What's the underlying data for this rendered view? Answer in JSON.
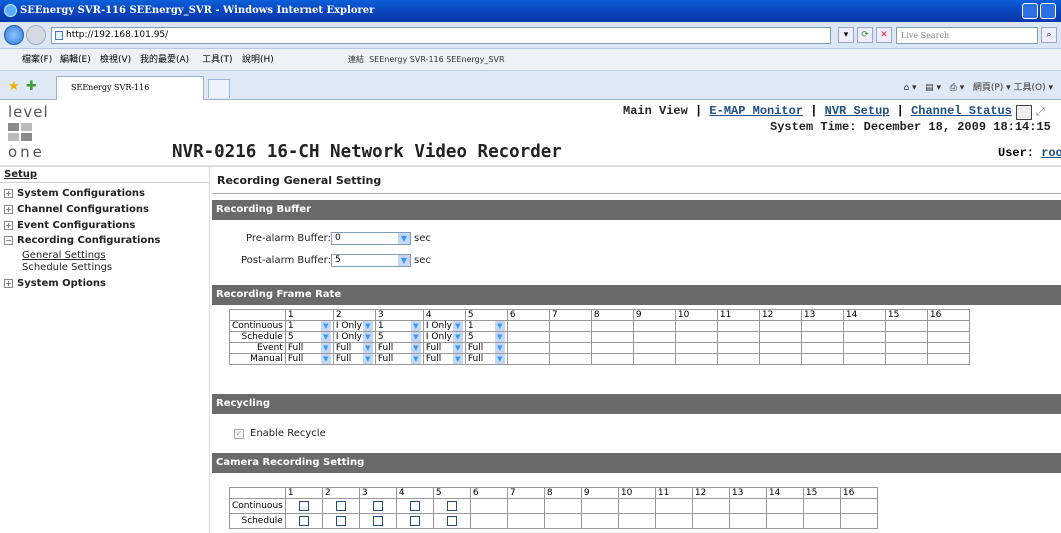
{
  "window": {
    "title": "SEEnergy SVR-116 SEEnergy_SVR - Windows Internet Explorer"
  },
  "browser": {
    "address": "http://192.168.101.95/",
    "search_placeholder": "Live Search",
    "menu": [
      "檔案(F)",
      "編輯(E)",
      "檢視(V)",
      "我的最愛(A)",
      "工具(T)",
      "說明(H)"
    ],
    "links_label": "連結",
    "link_item": "SEEnergy SVR-116 SEEnergy_SVR",
    "tab_title": "SEEnergy SVR-116 SEEnergy_SVR",
    "right_tools": "網頁(P) ▾  工具(O) ▾"
  },
  "header": {
    "logo_top": "level",
    "logo_bottom": "one",
    "title": "NVR-0216 16-CH Network Video Recorder",
    "nav": {
      "main_view": "Main View",
      "emap": "E-MAP Monitor",
      "nvr_setup": "NVR Setup",
      "channel_status": "Channel Status",
      "sep": " | "
    },
    "system_time": "System Time: December 18, 2009 18:14:15",
    "user_label": "User: ",
    "user_name": "root"
  },
  "sidebar": {
    "setup": "Setup",
    "items": [
      "System Configurations",
      "Channel Configurations",
      "Event Configurations",
      "Recording Configurations"
    ],
    "subitems": [
      "General Settings",
      "Schedule Settings"
    ],
    "last_item": "System Options"
  },
  "main": {
    "title": "Recording General Setting",
    "buffer": {
      "title": "Recording Buffer",
      "pre_label": "Pre-alarm Buffer:",
      "pre_value": "0",
      "post_label": "Post-alarm Buffer:",
      "post_value": "5",
      "unit": "sec"
    },
    "frame_rate": {
      "title": "Recording Frame Rate",
      "channels": [
        "1",
        "2",
        "3",
        "4",
        "5",
        "6",
        "7",
        "8",
        "9",
        "10",
        "11",
        "12",
        "13",
        "14",
        "15",
        "16"
      ],
      "rows": [
        {
          "label": "Continuous",
          "values": [
            "1",
            "I Only",
            "1",
            "I Only",
            "1"
          ]
        },
        {
          "label": "Schedule",
          "values": [
            "5",
            "I Only",
            "5",
            "I Only",
            "5"
          ]
        },
        {
          "label": "Event",
          "values": [
            "Full",
            "Full",
            "Full",
            "Full",
            "Full"
          ]
        },
        {
          "label": "Manual",
          "values": [
            "Full",
            "Full",
            "Full",
            "Full",
            "Full"
          ]
        }
      ]
    },
    "recycling": {
      "title": "Recycling",
      "label": "Enable Recycle"
    },
    "camera": {
      "title": "Camera Recording Setting",
      "rows": [
        "Continuous",
        "Schedule"
      ]
    }
  }
}
